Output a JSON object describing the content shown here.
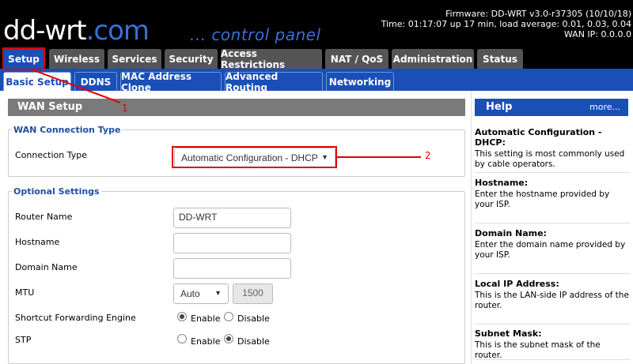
{
  "header": {
    "logo_main": "dd-wrt",
    "logo_suffix": ".com",
    "tagline": "... control panel",
    "firmware": "Firmware: DD-WRT v3.0-r37305 (10/10/18)",
    "time": "Time: 01:17:07 up 17 min, load average: 0.01, 0.03, 0.04",
    "wan_ip": "WAN IP: 0.0.0.0"
  },
  "tabs": [
    "Setup",
    "Wireless",
    "Services",
    "Security",
    "Access Restrictions",
    "NAT / QoS",
    "Administration",
    "Status"
  ],
  "subtabs": [
    "Basic Setup",
    "DDNS",
    "MAC Address Clone",
    "Advanced Routing",
    "Networking"
  ],
  "main": {
    "section_title": "WAN Setup",
    "wan_connection": {
      "legend": "WAN Connection Type",
      "label": "Connection Type",
      "value": "Automatic Configuration - DHCP"
    },
    "optional": {
      "legend": "Optional Settings",
      "router_name_label": "Router Name",
      "router_name_value": "DD-WRT",
      "hostname_label": "Hostname",
      "hostname_value": "",
      "domain_label": "Domain Name",
      "domain_value": "",
      "mtu_label": "MTU",
      "mtu_mode": "Auto",
      "mtu_value": "1500",
      "sfe_label": "Shortcut Forwarding Engine",
      "stp_label": "STP",
      "enable": "Enable",
      "disable": "Disable",
      "sfe_enabled": true,
      "stp_enabled": false
    }
  },
  "help": {
    "title": "Help",
    "more": "more...",
    "sections": [
      {
        "title": "Automatic Configuration - DHCP:",
        "desc": "This setting is most commonly used by cable operators."
      },
      {
        "title": "Hostname:",
        "desc": "Enter the hostname provided by your ISP."
      },
      {
        "title": "Domain Name:",
        "desc": "Enter the domain name provided by your ISP."
      },
      {
        "title": "Local IP Address:",
        "desc": "This is the LAN-side IP address of the router."
      },
      {
        "title": "Subnet Mask:",
        "desc": "This is the subnet mask of the router."
      }
    ]
  },
  "annotations": {
    "one": "1",
    "two": "2",
    "color": "#e00000"
  },
  "colors": {
    "accent": "#1a4fb8",
    "tab_inactive": "#555555",
    "header_bg": "#000000"
  }
}
